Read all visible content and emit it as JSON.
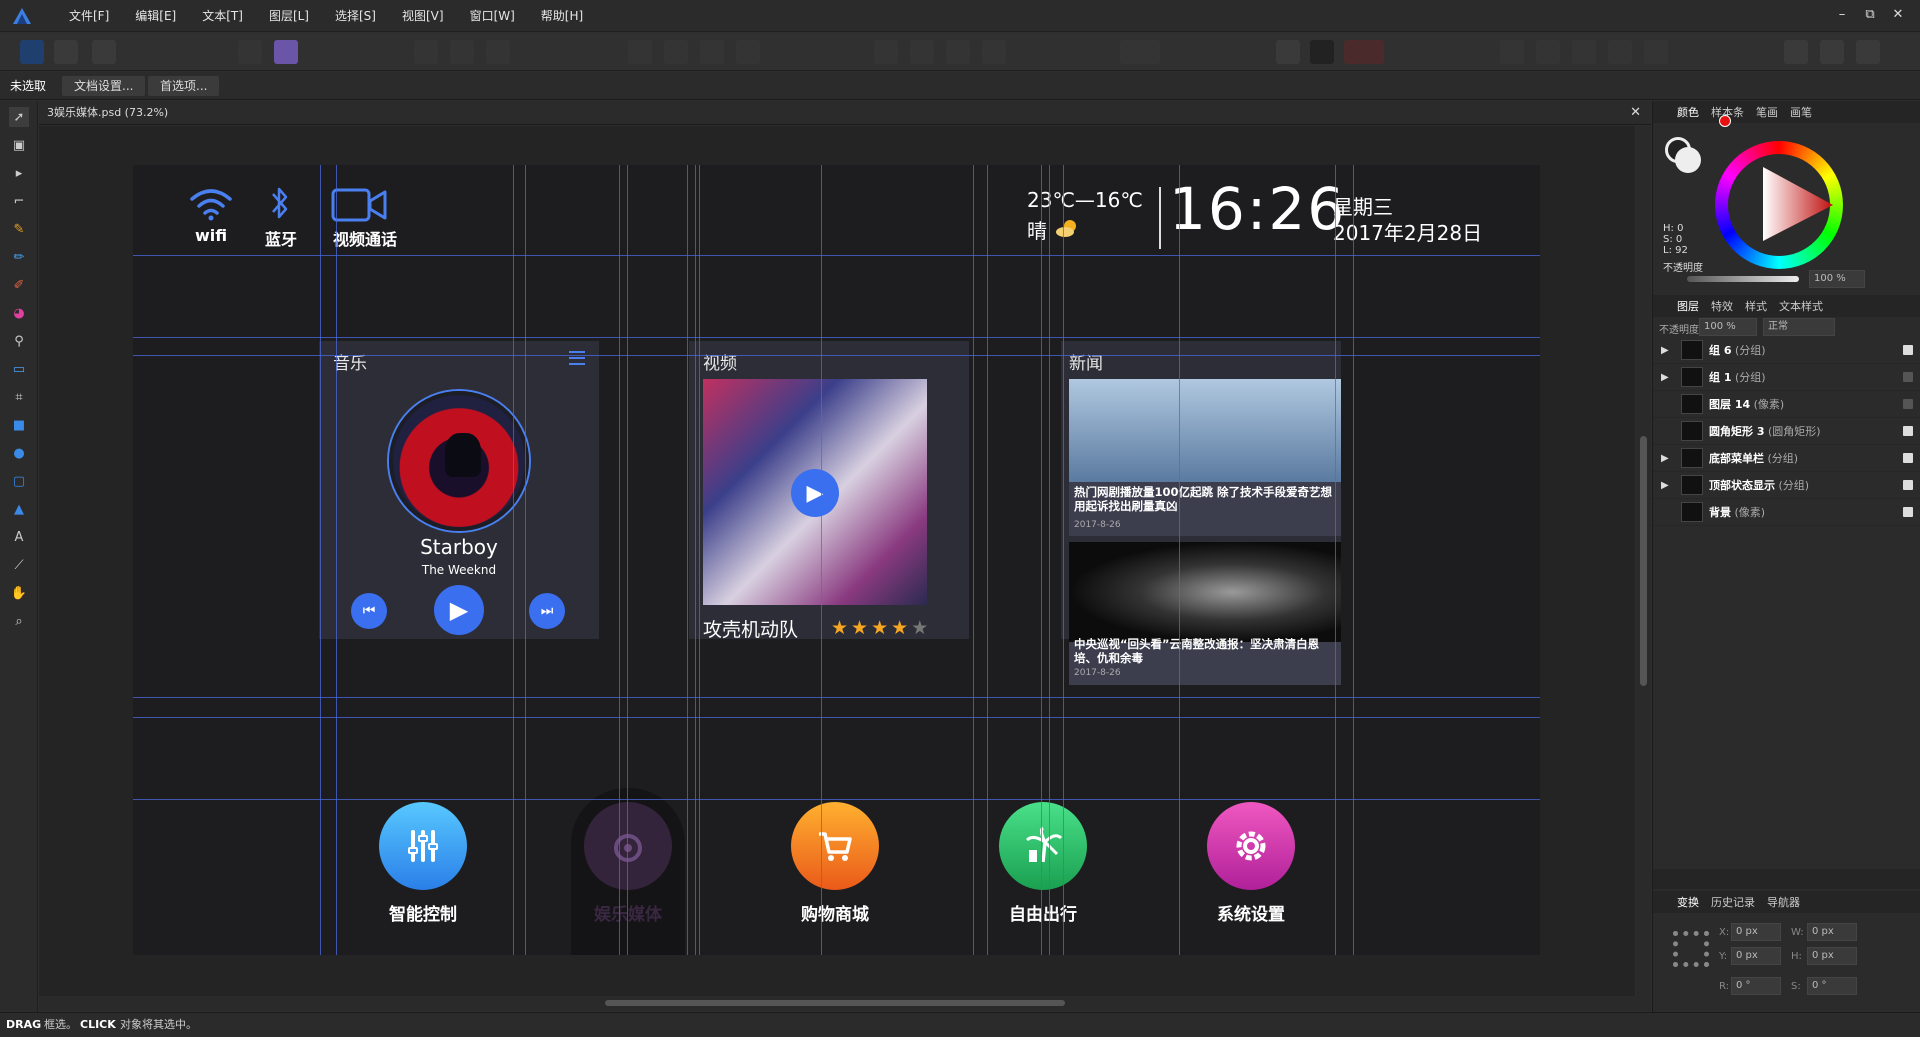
{
  "menu": [
    "文件[F]",
    "编辑[E]",
    "文本[T]",
    "图层[L]",
    "选择[S]",
    "视图[V]",
    "窗口[W]",
    "帮助[H]"
  ],
  "window_controls": [
    "–",
    "⧉",
    "✕"
  ],
  "context": {
    "selection": "未选取",
    "doc_settings": "文档设置...",
    "preferences": "首选项..."
  },
  "doc": {
    "tab": "3娱乐媒体.psd (73.2%)",
    "close": "✕"
  },
  "status": {
    "drag": "DRAG",
    "drag_text": "框选。",
    "click": "CLICK",
    "click_text": "对象将其选中。"
  },
  "screen": {
    "wifi": "wifi",
    "bluetooth": "蓝牙",
    "video_call": "视频通话",
    "temp": "23℃—16℃",
    "weather": "晴",
    "time": "16:26",
    "weekday": "星期三",
    "date": "2017年2月28日",
    "music_title": "音乐",
    "song": "Starboy",
    "artist": "The Weeknd",
    "video_title": "视频",
    "movie": "攻壳机动队",
    "rating": 4,
    "rating_max": 5,
    "news_title": "新闻",
    "news": [
      {
        "headline": "热门网剧播放量100亿起跳 除了技术手段爱奇艺想用起诉找出刷量真凶",
        "date": "2017-8-26"
      },
      {
        "headline": "中央巡视“回头看”云南整改通报：坚决肃清白恩培、仇和余毒",
        "date": "2017-8-26"
      }
    ],
    "bottom": [
      {
        "label": "智能控制",
        "icon": "sliders-icon",
        "color": "#3aa0f0"
      },
      {
        "label": "娱乐媒体",
        "icon": "music-icon",
        "color": "#6b3d86"
      },
      {
        "label": "购物商城",
        "icon": "cart-icon",
        "color": "#f07a1a"
      },
      {
        "label": "自由出行",
        "icon": "palm-tree-icon",
        "color": "#27c46a"
      },
      {
        "label": "系统设置",
        "icon": "gear-icon",
        "color": "#d63aa0"
      }
    ]
  },
  "color_panel": {
    "tabs": [
      "颜色",
      "样本条",
      "笔画",
      "画笔"
    ],
    "h": "H: 0",
    "s": "S: 0",
    "l": "L: 92",
    "opacity_label": "不透明度",
    "opacity": "100 %"
  },
  "layers_panel": {
    "tabs": [
      "图层",
      "特效",
      "样式",
      "文本样式"
    ],
    "opacity_label": "不透明度:",
    "opacity": "100 %",
    "blend": "正常",
    "layers": [
      {
        "name": "组 6",
        "type": "(分组)"
      },
      {
        "name": "组 1",
        "type": "(分组)"
      },
      {
        "name": "图层 14",
        "type": "(像素)"
      },
      {
        "name": "圆角矩形 3",
        "type": "(圆角矩形)"
      },
      {
        "name": "底部菜单栏",
        "type": "(分组)"
      },
      {
        "name": "顶部状态显示",
        "type": "(分组)"
      },
      {
        "name": "背景",
        "type": "(像素)"
      }
    ]
  },
  "transform_panel": {
    "tabs": [
      "变换",
      "历史记录",
      "导航器"
    ],
    "x_label": "X:",
    "x": "0 px",
    "y_label": "Y:",
    "y": "0 px",
    "w_label": "W:",
    "w": "0 px",
    "h_label": "H:",
    "h": "0 px",
    "r_label": "R:",
    "r": "0 °",
    "s_label": "S:",
    "s": "0 °"
  }
}
